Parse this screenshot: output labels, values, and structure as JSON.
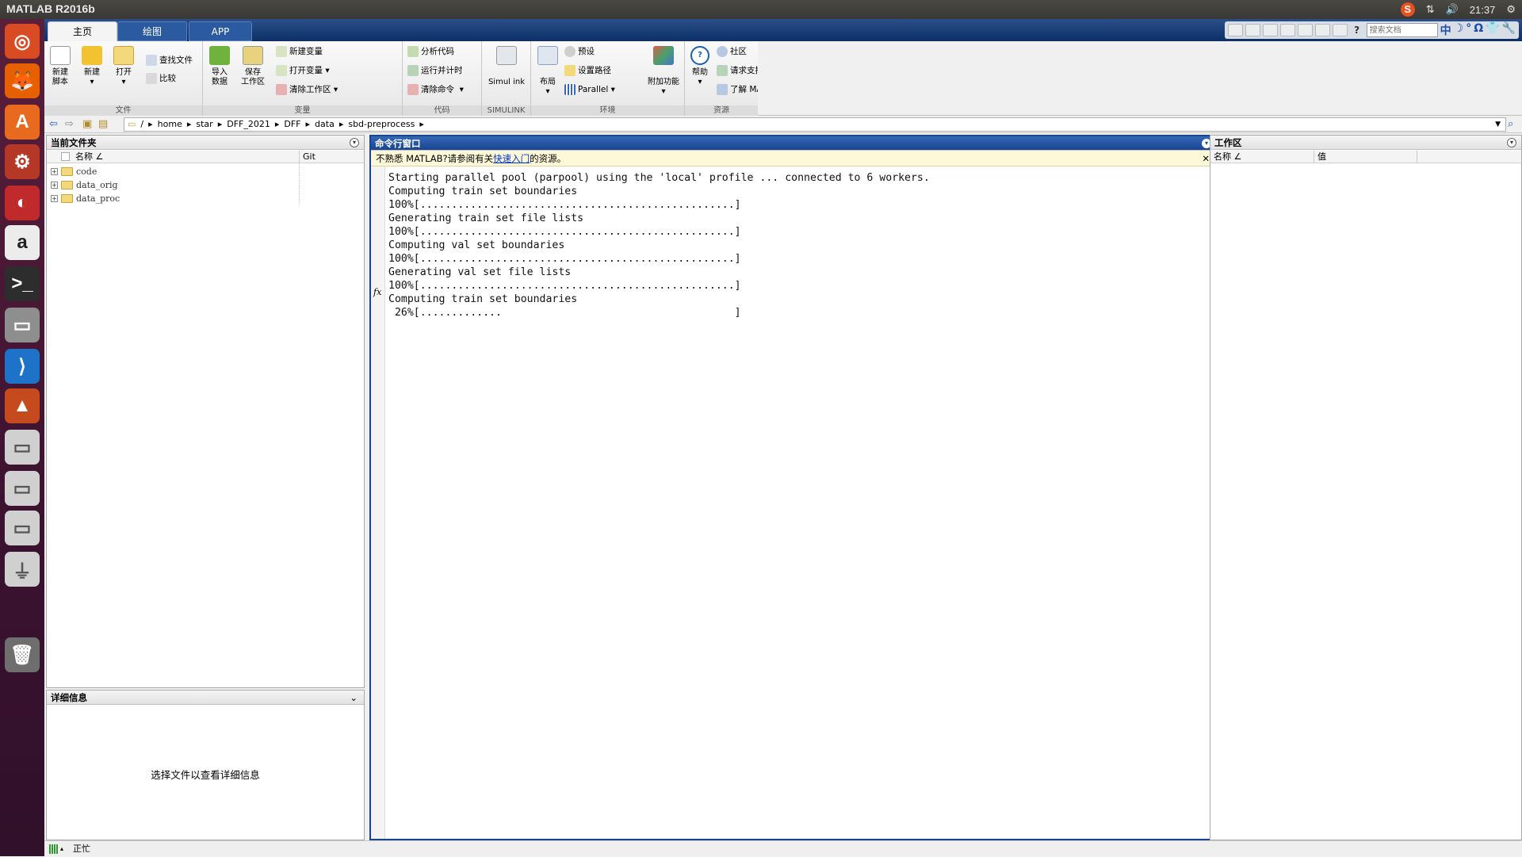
{
  "os": {
    "app_title": "MATLAB R2016b",
    "clock": "21:37",
    "tray_sogou": "S",
    "launcher": [
      {
        "name": "ubuntu-dash-icon",
        "glyph": "◎",
        "color": "#d94b22"
      },
      {
        "name": "firefox-icon",
        "glyph": "🦊",
        "color": "#e66000"
      },
      {
        "name": "software-center-icon",
        "glyph": "A",
        "color": "#e86a1e"
      },
      {
        "name": "system-settings-icon",
        "glyph": "⚙",
        "color": "#b53826"
      },
      {
        "name": "libreoffice-impress-icon",
        "glyph": "◐",
        "color": "#c02a2a"
      },
      {
        "name": "amazon-icon",
        "glyph": "a",
        "color": "#ececec"
      },
      {
        "name": "terminal-icon",
        "glyph": ">_",
        "color": "#2d2d2d"
      },
      {
        "name": "files-icon",
        "glyph": "▭",
        "color": "#8e8e8e"
      },
      {
        "name": "vscode-icon",
        "glyph": "⟩",
        "color": "#1e73c8"
      },
      {
        "name": "matlab-icon",
        "glyph": "▲",
        "color": "#c54b1e"
      },
      {
        "name": "drive-icon-1",
        "glyph": "▭",
        "color": "#d0d0d0"
      },
      {
        "name": "drive-icon-2",
        "glyph": "▭",
        "color": "#d0d0d0"
      },
      {
        "name": "drive-icon-3",
        "glyph": "▭",
        "color": "#d0d0d0"
      },
      {
        "name": "usb-drive-icon",
        "glyph": "⏚",
        "color": "#d0d0d0"
      },
      {
        "name": "trash-icon",
        "glyph": "🗑",
        "color": "#6e6e6e"
      }
    ]
  },
  "tabs": [
    {
      "label": "主页",
      "active": true
    },
    {
      "label": "绘图",
      "active": false
    },
    {
      "label": "APP",
      "active": false
    }
  ],
  "quickaccess": {
    "search_placeholder": "搜索文档",
    "help": "?",
    "ime": [
      "中",
      "☽",
      "°",
      "Ω",
      "👕",
      "🔧"
    ]
  },
  "ribbon": {
    "file": {
      "label": "文件",
      "new_script": "新建\n脚本",
      "new": "新建",
      "open": "打开",
      "find_files": "查找文件",
      "compare": "比较"
    },
    "variable": {
      "label": "变量",
      "import": "导入\n数据",
      "save": "保存\n工作区",
      "new_var": "新建变量",
      "open_var": "打开变量",
      "clear_ws": "清除工作区"
    },
    "code": {
      "label": "代码",
      "analyze": "分析代码",
      "run_time": "运行并计时",
      "clear_cmd": "清除命令"
    },
    "simulink": {
      "label": "SIMULINK",
      "simulink": "Simul ink"
    },
    "env": {
      "label": "环境",
      "layout": "布局",
      "prefs": "预设",
      "set_path": "设置路径",
      "parallel": "Parallel",
      "addons": "附加功能"
    },
    "resources": {
      "label": "资源",
      "help": "帮助",
      "community": "社区",
      "support": "请求支持",
      "learn": "了解 MATLAB"
    }
  },
  "path": [
    "/",
    "home",
    "star",
    "DFF_2021",
    "DFF",
    "data",
    "sbd-preprocess"
  ],
  "current_folder": {
    "title": "当前文件夹",
    "col_name": "名称 ∠",
    "col_git": "Git",
    "items": [
      "code",
      "data_orig",
      "data_proc"
    ]
  },
  "details": {
    "title": "详细信息",
    "placeholder": "选择文件以查看详细信息"
  },
  "command_window": {
    "title": "命令行窗口",
    "banner_prefix": "不熟悉 MATLAB?请参阅有关",
    "banner_link": "快速入门",
    "banner_suffix": "的资源。",
    "prompt": "fx",
    "lines": [
      "Starting parallel pool (parpool) using the 'local' profile ... connected to 6 workers.",
      "Computing train set boundaries",
      "100%[..................................................]",
      "Generating train set file lists",
      "100%[..................................................]",
      "Computing val set boundaries",
      "100%[..................................................]",
      "Generating val set file lists",
      "100%[..................................................]",
      "Computing train set boundaries",
      " 26%[.............                                     ]"
    ]
  },
  "workspace": {
    "title": "工作区",
    "col_name": "名称 ∠",
    "col_value": "值"
  },
  "status": {
    "text": "正忙"
  }
}
